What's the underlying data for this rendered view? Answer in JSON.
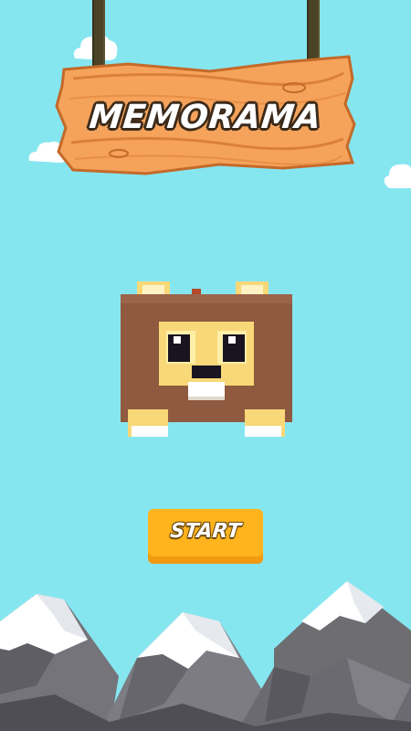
{
  "game": {
    "title": "MEMORAMA",
    "start_label": "START"
  },
  "character": {
    "name_icon": "lion-character-icon"
  },
  "colors": {
    "sky": "#86E6F0",
    "sign_wood": "#F5A25A",
    "rope": "#4A4326",
    "button": "#FFB31C",
    "lion_mane": "#8F5A3F",
    "lion_face": "#F8D878",
    "mountain_rock": "#7A7A7A",
    "mountain_snow": "#FFFFFF"
  }
}
